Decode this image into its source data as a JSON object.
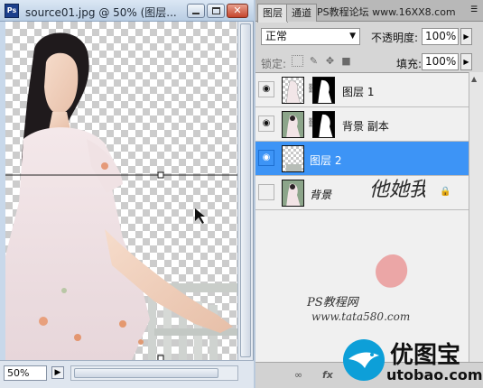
{
  "document": {
    "app_logo_text": "Ps",
    "title": "source01.jpg @ 50% (图层...",
    "zoom": "50%",
    "status_icon": "▶"
  },
  "layers_panel": {
    "tabs": [
      "图层",
      "通道"
    ],
    "forum_watermark": "PS教程论坛 www.16XX8.com",
    "blend_mode": "正常",
    "opacity_label": "不透明度:",
    "opacity_value": "100%",
    "lock_label": "锁定:",
    "fill_label": "填充:",
    "fill_value": "100%",
    "layers": [
      {
        "name": "图层 1",
        "visible": true,
        "selected": false,
        "has_mask": true
      },
      {
        "name": "背景 副本",
        "visible": true,
        "selected": false,
        "has_mask": true
      },
      {
        "name": "图层 2",
        "visible": true,
        "selected": true,
        "has_mask": false
      },
      {
        "name": "背景",
        "visible": false,
        "selected": false,
        "has_mask": false,
        "locked": true
      }
    ],
    "footer_icons": [
      "link-icon",
      "fx-icon"
    ]
  },
  "watermark": {
    "calligraphy": "他她我帮你",
    "ps_site": "PS教程网",
    "ps_url": "www.tata580.com",
    "brand_name": "优图宝",
    "brand_url": "utobao.com"
  },
  "colors": {
    "selection_blue": "#3d94f6",
    "title_bar": "#c8d8ea"
  }
}
